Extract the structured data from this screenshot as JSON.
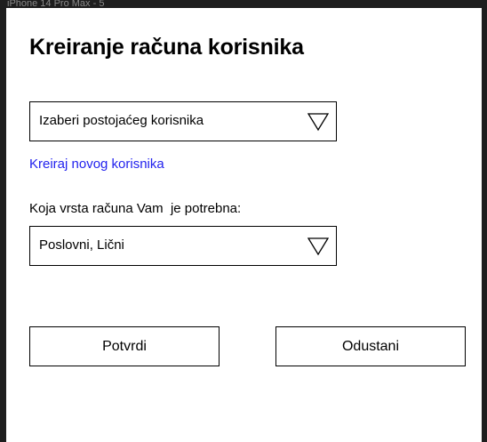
{
  "frame": {
    "label": "iPhone 14 Pro Max - 5"
  },
  "page": {
    "title": "Kreiranje računa korisnika"
  },
  "user_select": {
    "value": "Izaberi postojaćeg korisnika",
    "icon": "triangle-down-icon"
  },
  "create_link": {
    "label": "Kreiraj novog korisnika",
    "color": "#2222ee"
  },
  "account_type": {
    "label": "Koja vrsta računa Vam  je potrebna:",
    "value": "Poslovni, Lični",
    "icon": "triangle-down-icon"
  },
  "actions": {
    "confirm_label": "Potvrdi",
    "cancel_label": "Odustani"
  }
}
